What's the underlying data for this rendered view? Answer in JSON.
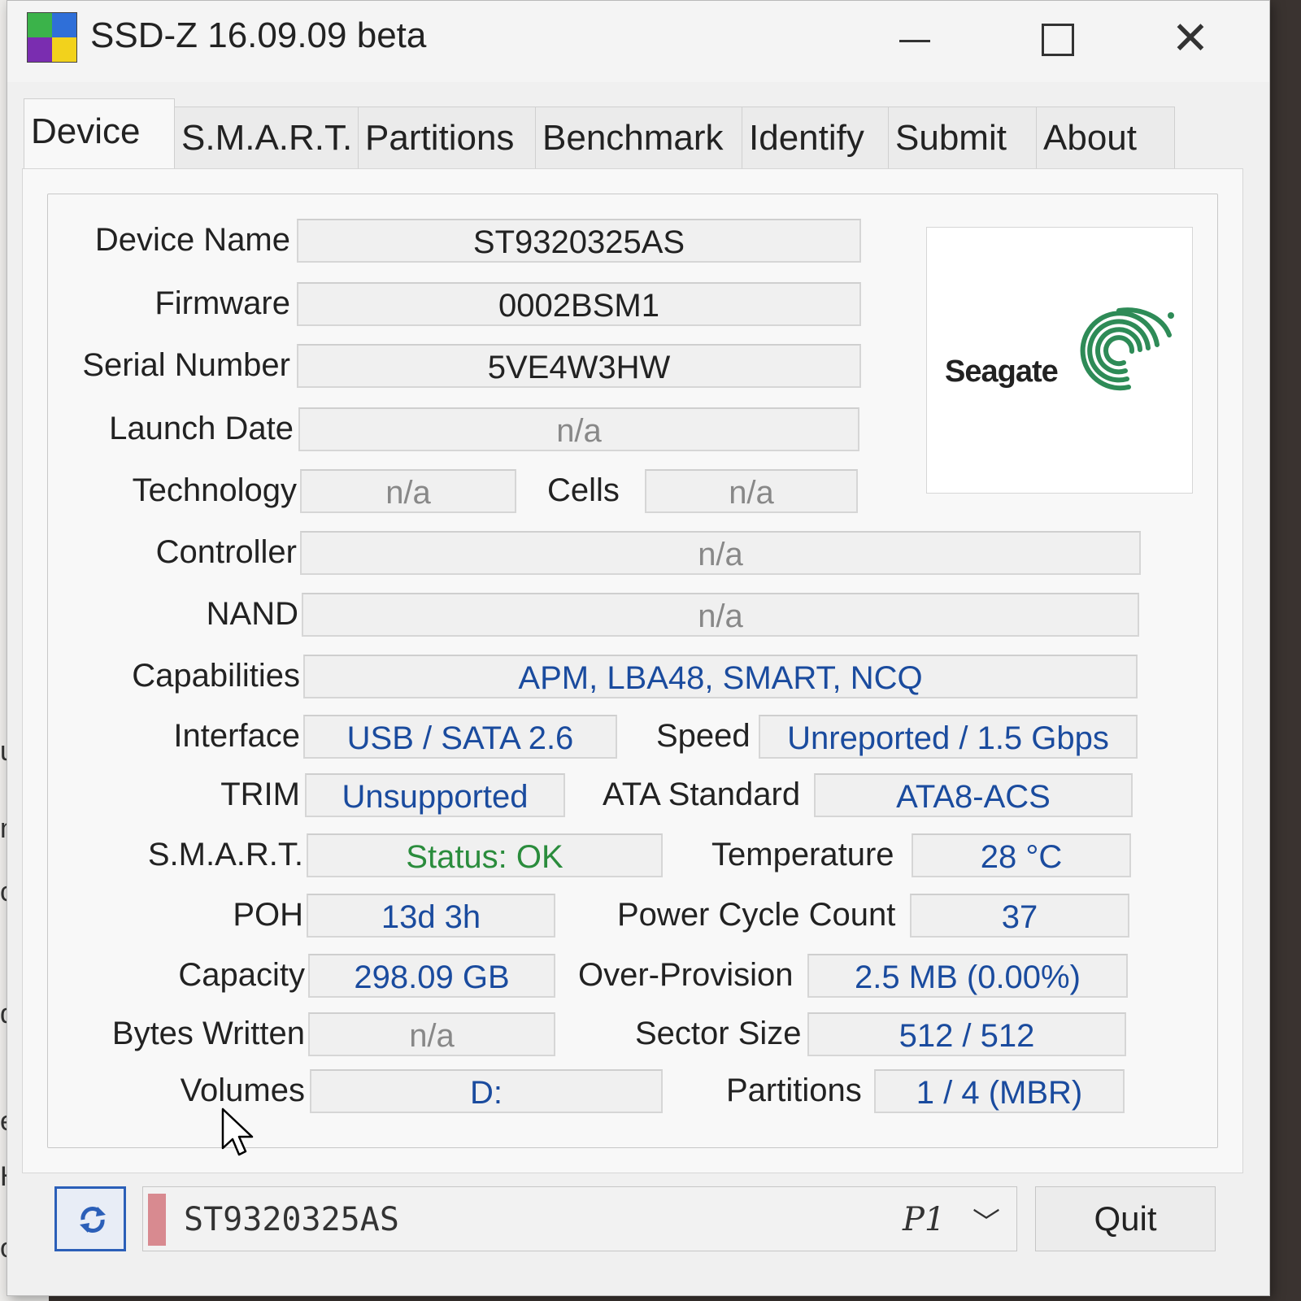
{
  "window": {
    "title": "SSD-Z 16.09.09 beta"
  },
  "tabs": [
    "Device",
    "S.M.A.R.T.",
    "Partitions",
    "Benchmark",
    "Identify",
    "Submit",
    "About"
  ],
  "device": {
    "labels": {
      "device_name": "Device Name",
      "firmware": "Firmware",
      "serial_number": "Serial Number",
      "launch_date": "Launch Date",
      "technology": "Technology",
      "cells": "Cells",
      "controller": "Controller",
      "nand": "NAND",
      "capabilities": "Capabilities",
      "interface": "Interface",
      "speed": "Speed",
      "trim": "TRIM",
      "ata_standard": "ATA Standard",
      "smart": "S.M.A.R.T.",
      "temperature": "Temperature",
      "poh": "POH",
      "power_cycle_count": "Power Cycle Count",
      "capacity": "Capacity",
      "over_provision": "Over-Provision",
      "bytes_written": "Bytes Written",
      "sector_size": "Sector Size",
      "volumes": "Volumes",
      "partitions": "Partitions"
    },
    "values": {
      "device_name": "ST9320325AS",
      "firmware": "0002BSM1",
      "serial_number": "5VE4W3HW",
      "launch_date": "n/a",
      "technology": "n/a",
      "cells": "n/a",
      "controller": "n/a",
      "nand": "n/a",
      "capabilities": "APM, LBA48, SMART, NCQ",
      "interface": "USB / SATA 2.6",
      "speed": "Unreported / 1.5 Gbps",
      "trim": "Unsupported",
      "ata_standard": "ATA8-ACS",
      "smart": "Status: OK",
      "temperature": "28 °C",
      "poh": "13d 3h",
      "power_cycle_count": "37",
      "capacity": "298.09 GB",
      "over_provision": "2.5 MB (0.00%)",
      "bytes_written": "n/a",
      "sector_size": "512 / 512",
      "volumes": "D:",
      "partitions": "1 / 4 (MBR)"
    },
    "logo": {
      "brand": "Seagate",
      "icon": "seagate-logo-icon",
      "color": "#2e8b57"
    }
  },
  "bottom": {
    "refresh_icon": "refresh-icon",
    "drive_name": "ST9320325AS",
    "drive_port": "P1",
    "quit_label": "Quit"
  },
  "background": {
    "fragments": [
      "ul",
      "ni",
      "ca",
      "dev",
      "el",
      "HD",
      "otio"
    ]
  },
  "colors": {
    "value_text": "#1a4b9e",
    "ok_text": "#2a8c3c",
    "na_text": "#888888"
  }
}
